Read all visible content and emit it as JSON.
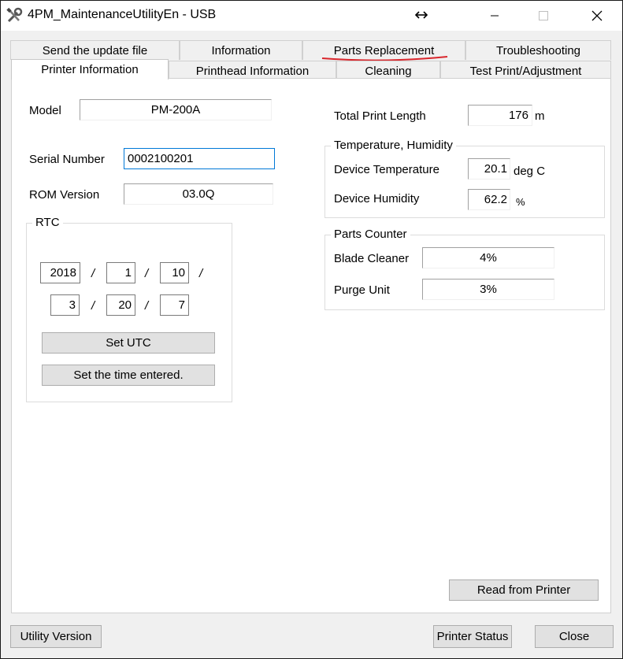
{
  "window": {
    "title": "4PM_MaintenanceUtilityEn - USB",
    "app_icon": "tools-icon",
    "resize_icon": "resize-horizontal-icon"
  },
  "tabs_row1": [
    {
      "label": "Send the update file"
    },
    {
      "label": "Information"
    },
    {
      "label": "Parts Replacement"
    },
    {
      "label": "Troubleshooting"
    }
  ],
  "tabs_row2": [
    {
      "label": "Printer Information",
      "active": true
    },
    {
      "label": "Printhead Information"
    },
    {
      "label": "Cleaning"
    },
    {
      "label": "Test Print/Adjustment"
    }
  ],
  "printer_info": {
    "model_label": "Model",
    "model_value": "PM-200A",
    "serial_label": "Serial Number",
    "serial_value": "0002100201",
    "rom_label": "ROM Version",
    "rom_value": "03.0Q"
  },
  "rtc": {
    "title": "RTC",
    "year": "2018",
    "month": "1",
    "day": "10",
    "hour": "3",
    "minute": "20",
    "second": "7",
    "separator": "/",
    "set_utc_label": "Set UTC",
    "set_entered_label": "Set the time entered."
  },
  "print_length": {
    "label": "Total Print Length",
    "value": "176",
    "unit": "m"
  },
  "temp_humidity": {
    "title": "Temperature, Humidity",
    "temp_label": "Device Temperature",
    "temp_value": "20.1",
    "temp_unit": "deg C",
    "humidity_label": "Device Humidity",
    "humidity_value": "62.2",
    "humidity_unit": "%"
  },
  "parts_counter": {
    "title": "Parts Counter",
    "blade_label": "Blade Cleaner",
    "blade_value": "4%",
    "purge_label": "Purge Unit",
    "purge_value": "3%"
  },
  "buttons": {
    "read_from_printer": "Read from Printer",
    "utility_version": "Utility Version",
    "printer_status": "Printer Status",
    "close": "Close"
  },
  "annotation": {
    "color": "#d9262c"
  }
}
